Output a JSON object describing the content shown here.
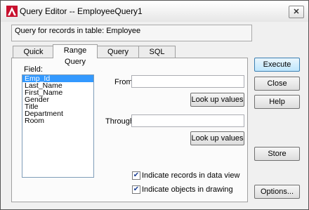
{
  "window": {
    "title": "Query Editor -- EmployeeQuery1",
    "close_glyph": "✕"
  },
  "info_text": "Query for records in table:  Employee",
  "tabs": [
    {
      "label": "Quick Query"
    },
    {
      "label": "Range Query"
    },
    {
      "label": "Query Builder"
    },
    {
      "label": "SQL Query"
    }
  ],
  "active_tab": "Range Query",
  "field": {
    "label": "Field:",
    "items": [
      "Emp_Id",
      "Last_Name",
      "First_Name",
      "Gender",
      "Title",
      "Department",
      "Room"
    ],
    "selected": "Emp_Id"
  },
  "from": {
    "label": "From:",
    "value": "",
    "lookup_label": "Look up values"
  },
  "through": {
    "label": "Through:",
    "value": "",
    "lookup_label": "Look up values"
  },
  "options": {
    "indicate_records": {
      "label": "Indicate records in data view",
      "checked": true
    },
    "indicate_objects": {
      "label": "Indicate objects in drawing",
      "checked": true
    }
  },
  "buttons": {
    "execute": "Execute",
    "close": "Close",
    "help": "Help",
    "store": "Store",
    "options": "Options..."
  },
  "check_glyph": "✔",
  "colors": {
    "selection": "#3399ff",
    "default_button_border": "#3c7fb1"
  }
}
